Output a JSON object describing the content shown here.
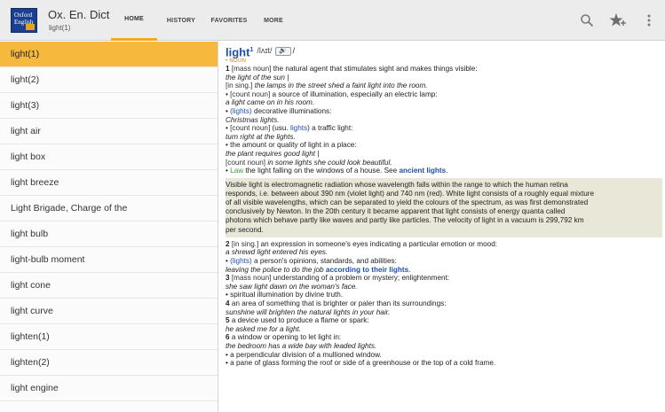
{
  "app": {
    "logo_text": "Oxford English",
    "title": "Ox. En. Dict",
    "subtitle": "light(1)"
  },
  "tabs": [
    {
      "label": "HOME",
      "active": true
    },
    {
      "label": "HISTORY",
      "active": false
    },
    {
      "label": "FAVORITES",
      "active": false
    },
    {
      "label": "MORE",
      "active": false
    }
  ],
  "actions": {
    "search_icon": "search-icon",
    "favorite_icon": "star-plus-icon",
    "menu_icon": "overflow-menu-icon"
  },
  "word_list": [
    "light(1)",
    "light(2)",
    "light(3)",
    "light air",
    "light box",
    "light breeze",
    "Light Brigade, Charge of the",
    "light bulb",
    "light-bulb moment",
    "light cone",
    "light curve",
    "lighten(1)",
    "lighten(2)",
    "light engine"
  ],
  "entry": {
    "headword": "light",
    "homograph": "1",
    "pronunciation": "/lʌɪt/",
    "audio_label": "🔊",
    "slash": "/",
    "pos_label": "NOUN",
    "lines": {
      "s1": "1",
      "s1_gram": "[mass noun]",
      "s1_def": " the natural agent that stimulates sight and makes things visible:",
      "s1_ex1": "the light of the sun |",
      "s1_gram2": "[in sing.]",
      "s1_ex2": " the lamps in the street shed a faint light into the room.",
      "s1b_gram": "[count noun]",
      "s1b_def": " a source of illumination, especially an electric lamp:",
      "s1b_ex": "a light came on in his room.",
      "s1c_lnk": "(lights)",
      "s1c_def": " decorative illuminations:",
      "s1c_ex": "Christmas lights.",
      "s1d_gram": "[count noun]",
      "s1d_pre": " (usu. ",
      "s1d_lnk": "lights",
      "s1d_def": ") a traffic light:",
      "s1d_ex": "turn right at the lights.",
      "s1e_def": "the amount or quality of light in a place:",
      "s1e_ex1": "the plant requires good light |",
      "s1e_gram": "[count noun]",
      "s1e_ex2": " in some lights she could look beautiful.",
      "s1f_law": "Law",
      "s1f_def": " the light falling on the windows of a house. See ",
      "s1f_lnk": "ancient lights",
      "s1f_end": ".",
      "note1": "Visible light is electromagnetic radiation whose wavelength falls within the range to which the human retina",
      "note2": "responds, i.e. between about 390 nm (violet light) and 740 nm (red). White light consists of a roughly equal mixture",
      "note3": "of all visible wavelengths, which can be separated to yield the colours of the spectrum, as was first demonstrated",
      "note4": "conclusively by Newton. In the 20th century it became apparent that light consists of energy quanta called",
      "note5": "photons which behave partly like waves and partly like particles. The velocity of light in a vacuum is 299,792 km",
      "note6": "per second.",
      "s2": "2",
      "s2_gram": "[in sing.]",
      "s2_def": " an expression in someone's eyes indicating a particular emotion or mood:",
      "s2_ex": "a shrewd light entered his eyes.",
      "s2b_lnk": "(lights)",
      "s2b_def": " a person's opinions, standards, and abilities:",
      "s2b_ex": "leaving the police to do the job ",
      "s2b_lnk2": "according to their lights",
      "s2b_end": ".",
      "s3": "3",
      "s3_gram": "[mass noun]",
      "s3_def": " understanding of a problem or mystery; enlightenment:",
      "s3_ex": "she saw light dawn on the woman's face.",
      "s3b_def": "spiritual illumination by divine truth.",
      "s4": "4",
      "s4_def": " an area of something that is brighter or paler than its surroundings:",
      "s4_ex": "sunshine will brighten the natural lights in your hair.",
      "s5": "5",
      "s5_def": " a device used to produce a flame or spark:",
      "s5_ex": "he asked me for a light.",
      "s6": "6",
      "s6_def": " a window or opening to let light in:",
      "s6_ex": "the bedroom has a wide bay with leaded lights.",
      "s6b_def": "a perpendicular division of a mullioned window.",
      "s6c_def": "a pane of glass forming the roof or side of a greenhouse or the top of a cold frame."
    }
  },
  "colors": {
    "accent": "#f6b83d",
    "link": "#1f4fa8",
    "pos": "#e07a17",
    "law": "#3a9a3a",
    "note_bg": "#e9e7d8"
  }
}
